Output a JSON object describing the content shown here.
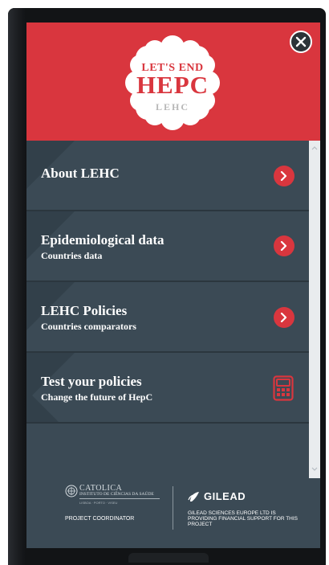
{
  "header": {
    "logo_line1": "LET'S END",
    "logo_line2": "HEPC",
    "logo_line3": "LEHC",
    "close_icon": "close-icon"
  },
  "menu": {
    "items": [
      {
        "title": "About LEHC",
        "subtitle": "",
        "action_icon": "chevron-right-icon"
      },
      {
        "title": "Epidemiological data",
        "subtitle": "Countries data",
        "action_icon": "chevron-right-icon"
      },
      {
        "title": "LEHC Policies",
        "subtitle": "Countries comparators",
        "action_icon": "chevron-right-icon"
      },
      {
        "title": "Test your policies",
        "subtitle": "Change the future of HepC",
        "action_icon": "calculator-icon"
      }
    ]
  },
  "footer": {
    "catolica": {
      "name": "CATOLICA",
      "institute": "INSTITUTO DE CIÊNCIAS DA SAÚDE",
      "sub": "LISBOA · PORTO · VISEU",
      "role": "PROJECT COORDINATOR"
    },
    "gilead": {
      "name": "GILEAD",
      "statement": "GILEAD SCIENCES EUROPE LTD IS PROVIDING FINANCIAL SUPPORT FOR THIS PROJECT"
    }
  },
  "colors": {
    "brand_red": "#d9363e",
    "panel": "#3b4a55",
    "panel_dark": "#32404a"
  }
}
